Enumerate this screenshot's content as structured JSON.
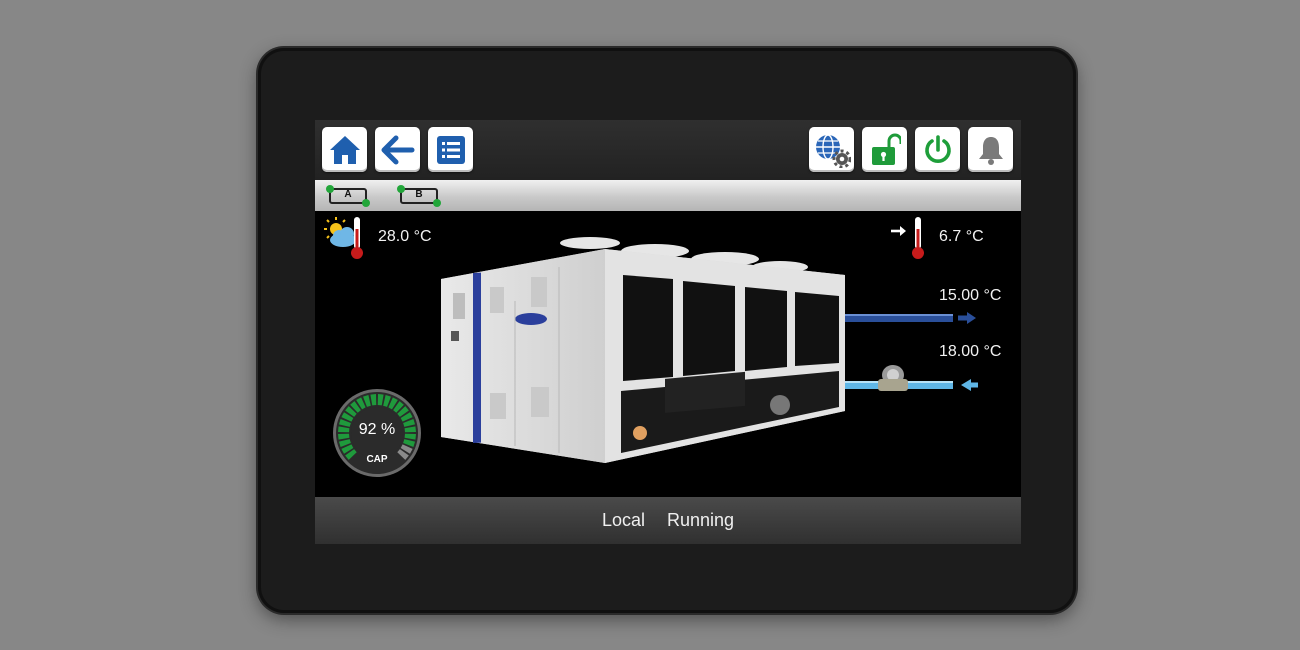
{
  "toolbar": {
    "left_buttons": [
      {
        "name": "home-button",
        "icon": "home-icon"
      },
      {
        "name": "back-button",
        "icon": "arrow-left-icon"
      },
      {
        "name": "menu-button",
        "icon": "list-icon"
      }
    ],
    "right_buttons": [
      {
        "name": "network-settings-button",
        "icon": "globe-gear-icon"
      },
      {
        "name": "login-button",
        "icon": "unlocked-padlock-icon"
      },
      {
        "name": "start-stop-button",
        "icon": "power-icon"
      },
      {
        "name": "alarms-button",
        "icon": "bell-icon"
      }
    ]
  },
  "circuits": [
    {
      "label": "A",
      "status_color": "#22a63a"
    },
    {
      "label": "B",
      "status_color": "#22a63a"
    }
  ],
  "outdoor": {
    "icon": "sun-cloud-icon",
    "temperature": "28.0 °C"
  },
  "setpoint": {
    "icon": "arrow-right-icon",
    "temperature": "6.7 °C"
  },
  "water_leaving": {
    "temperature": "15.00 °C"
  },
  "water_entering": {
    "temperature": "18.00 °C"
  },
  "capacity": {
    "value_text": "92 %",
    "value": 92,
    "label": "CAP"
  },
  "status": {
    "mode": "Local",
    "state": "Running"
  },
  "colors": {
    "icon_blue": "#1f5fae",
    "lock_green": "#1f9b3a",
    "power_green": "#1e9e3a",
    "gauge_green": "#1f9a3c",
    "pipe_dark_blue": "#2a4f9a",
    "pipe_light_blue": "#5fb6e6",
    "thermometer_red": "#c61b1b"
  }
}
